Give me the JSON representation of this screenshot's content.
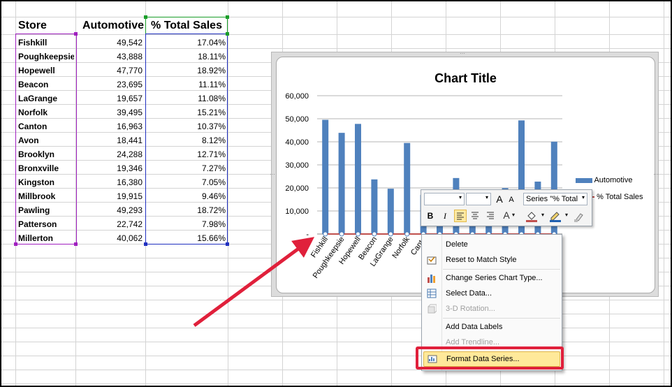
{
  "table": {
    "headers": {
      "store": "Store",
      "automotive": "Automotive",
      "pct": "% Total Sales"
    },
    "rows": [
      {
        "store": "Fishkill",
        "automotive": "49,542",
        "pct": "17.04%"
      },
      {
        "store": "Poughkeepsie",
        "automotive": "43,888",
        "pct": "18.11%"
      },
      {
        "store": "Hopewell",
        "automotive": "47,770",
        "pct": "18.92%"
      },
      {
        "store": "Beacon",
        "automotive": "23,695",
        "pct": "11.11%"
      },
      {
        "store": "LaGrange",
        "automotive": "19,657",
        "pct": "11.08%"
      },
      {
        "store": "Norfolk",
        "automotive": "39,495",
        "pct": "15.21%"
      },
      {
        "store": "Canton",
        "automotive": "16,963",
        "pct": "10.37%"
      },
      {
        "store": "Avon",
        "automotive": "18,441",
        "pct": "8.12%"
      },
      {
        "store": "Brooklyn",
        "automotive": "24,288",
        "pct": "12.71%"
      },
      {
        "store": "Bronxville",
        "automotive": "19,346",
        "pct": "7.27%"
      },
      {
        "store": "Kingston",
        "automotive": "16,380",
        "pct": "7.05%"
      },
      {
        "store": "Millbrook",
        "automotive": "19,915",
        "pct": "9.46%"
      },
      {
        "store": "Pawling",
        "automotive": "49,293",
        "pct": "18.72%"
      },
      {
        "store": "Patterson",
        "automotive": "22,742",
        "pct": "7.98%"
      },
      {
        "store": "Millerton",
        "automotive": "40,062",
        "pct": "15.66%"
      }
    ]
  },
  "chart_data": {
    "type": "bar",
    "title": "Chart Title",
    "categories": [
      "Fishkill",
      "Poughkeepsie",
      "Hopewell",
      "Beacon",
      "LaGrange",
      "Norfolk",
      "Canton",
      "Avon",
      "Brooklyn",
      "Bronxville",
      "Kingston",
      "Millbrook",
      "Pawling",
      "Patterson",
      "Millerton"
    ],
    "visible_category_labels": [
      "Fishkill",
      "Poughkeepsie",
      "Hopewell",
      "Beacon",
      "LaGrange",
      "Norfolk",
      "Canto"
    ],
    "series": [
      {
        "name": "Automotive",
        "type": "bar",
        "color": "#4f81bd",
        "values": [
          49542,
          43888,
          47770,
          23695,
          19657,
          39495,
          16963,
          18441,
          24288,
          19346,
          16380,
          19915,
          49293,
          22742,
          40062
        ]
      },
      {
        "name": "% Total Sales",
        "type": "line",
        "color": "#c0504d",
        "values": [
          0.1704,
          0.1811,
          0.1892,
          0.1111,
          0.1108,
          0.1521,
          0.1037,
          0.0812,
          0.1271,
          0.0727,
          0.0705,
          0.0946,
          0.1872,
          0.0798,
          0.1566
        ]
      }
    ],
    "ylim": [
      0,
      60000
    ],
    "yticks": [
      "60,000",
      "50,000",
      "40,000",
      "30,000",
      "20,000",
      "10,000",
      "-"
    ],
    "grid": true,
    "legend": "right"
  },
  "mini_toolbar": {
    "font_name": "",
    "font_size": "",
    "grow_font": "A",
    "shrink_font": "A",
    "series_select": "Series \"% Total",
    "bold": "B",
    "italic": "I",
    "font_color": "A"
  },
  "context_menu": {
    "items": [
      {
        "label": "Delete",
        "icon": "",
        "enabled": true
      },
      {
        "label": "Reset to Match Style",
        "icon": "reset-style-icon",
        "enabled": true
      },
      {
        "label": "Change Series Chart Type...",
        "icon": "chart-type-icon",
        "enabled": true
      },
      {
        "label": "Select Data...",
        "icon": "select-data-icon",
        "enabled": true
      },
      {
        "label": "3-D Rotation...",
        "icon": "3d-rotation-icon",
        "enabled": false
      },
      {
        "label": "Add Data Labels",
        "icon": "",
        "enabled": true
      },
      {
        "label": "Add Trendline...",
        "icon": "",
        "enabled": false
      },
      {
        "label": "Format Data Series...",
        "icon": "format-series-icon",
        "enabled": true,
        "highlighted": true
      }
    ]
  },
  "colors": {
    "accent_red": "#e0203b",
    "bar_blue": "#4f81bd",
    "line_red": "#c0504d",
    "highlight": "#ffe99a",
    "purple_sel": "#a020c0",
    "green_sel": "#1a9e2a",
    "blue_sel": "#2030c0"
  }
}
